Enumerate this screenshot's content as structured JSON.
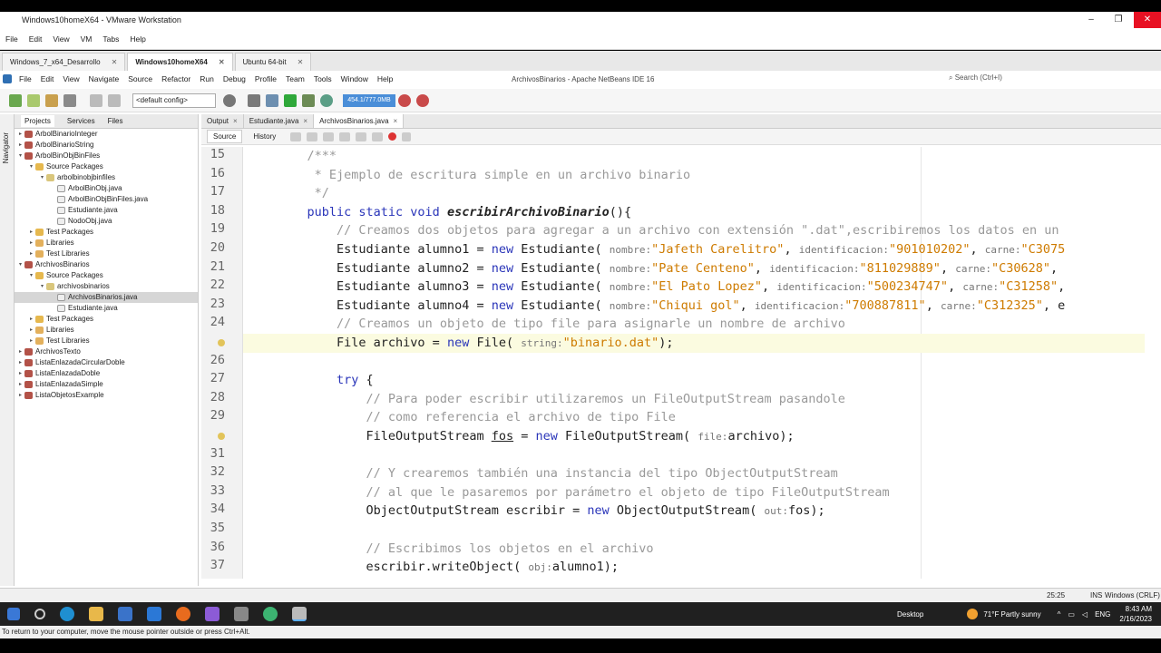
{
  "vm": {
    "title": "Windows10homeX64 - VMware Workstation",
    "menu": [
      "File",
      "Edit",
      "View",
      "VM",
      "Tabs",
      "Help"
    ],
    "tabs": [
      {
        "label": "Windows_7_x64_Desarrollo",
        "active": false
      },
      {
        "label": "Windows10homeX64",
        "active": true
      },
      {
        "label": "Ubuntu 64-bit",
        "active": false
      }
    ],
    "status": "To return to your computer, move the mouse pointer outside or press Ctrl+Alt."
  },
  "netbeans": {
    "title": "ArchivosBinarios - Apache NetBeans IDE 16",
    "search_placeholder": "Search (Ctrl+I)",
    "menu": [
      "File",
      "Edit",
      "View",
      "Navigate",
      "Source",
      "Refactor",
      "Run",
      "Debug",
      "Profile",
      "Team",
      "Tools",
      "Window",
      "Help"
    ],
    "config": "<default config>",
    "memory": "454.1/777.0MB",
    "side_label": "Navigator",
    "panel_tabs": [
      "Projects",
      "Services",
      "Files"
    ],
    "tree": [
      {
        "label": "ArbolBinarioInteger",
        "indent": 0,
        "icon": "p",
        "tw": "+"
      },
      {
        "label": "ArbolBinarioString",
        "indent": 0,
        "icon": "p",
        "tw": "+"
      },
      {
        "label": "ArbolBinObjBinFiles",
        "indent": 0,
        "icon": "p",
        "tw": "-"
      },
      {
        "label": "Source Packages",
        "indent": 1,
        "icon": "f",
        "tw": "-"
      },
      {
        "label": "arbolbinobjbinfiles",
        "indent": 2,
        "icon": "k",
        "tw": "-"
      },
      {
        "label": "ArbolBinObj.java",
        "indent": 3,
        "icon": "j",
        "tw": ""
      },
      {
        "label": "ArbolBinObjBinFiles.java",
        "indent": 3,
        "icon": "j",
        "tw": ""
      },
      {
        "label": "Estudiante.java",
        "indent": 3,
        "icon": "j",
        "tw": ""
      },
      {
        "label": "NodoObj.java",
        "indent": 3,
        "icon": "j",
        "tw": ""
      },
      {
        "label": "Test Packages",
        "indent": 1,
        "icon": "f",
        "tw": "+"
      },
      {
        "label": "Libraries",
        "indent": 1,
        "icon": "l",
        "tw": "+"
      },
      {
        "label": "Test Libraries",
        "indent": 1,
        "icon": "l",
        "tw": "+"
      },
      {
        "label": "ArchivosBinarios",
        "indent": 0,
        "icon": "p",
        "tw": "-"
      },
      {
        "label": "Source Packages",
        "indent": 1,
        "icon": "f",
        "tw": "-"
      },
      {
        "label": "archivosbinarios",
        "indent": 2,
        "icon": "k",
        "tw": "-"
      },
      {
        "label": "ArchivosBinarios.java",
        "indent": 3,
        "icon": "j",
        "tw": "",
        "sel": true
      },
      {
        "label": "Estudiante.java",
        "indent": 3,
        "icon": "j",
        "tw": ""
      },
      {
        "label": "Test Packages",
        "indent": 1,
        "icon": "f",
        "tw": "+"
      },
      {
        "label": "Libraries",
        "indent": 1,
        "icon": "l",
        "tw": "+"
      },
      {
        "label": "Test Libraries",
        "indent": 1,
        "icon": "l",
        "tw": "+"
      },
      {
        "label": "ArchivosTexto",
        "indent": 0,
        "icon": "p",
        "tw": "+"
      },
      {
        "label": "ListaEnlazadaCircularDoble",
        "indent": 0,
        "icon": "p",
        "tw": "+"
      },
      {
        "label": "ListaEnlazadaDoble",
        "indent": 0,
        "icon": "p",
        "tw": "+"
      },
      {
        "label": "ListaEnlazadaSimple",
        "indent": 0,
        "icon": "p",
        "tw": "+"
      },
      {
        "label": "ListaObjetosExample",
        "indent": 0,
        "icon": "p",
        "tw": "+"
      }
    ],
    "editor_tabs": [
      {
        "label": "Output",
        "active": false
      },
      {
        "label": "Estudiante.java",
        "active": false
      },
      {
        "label": "ArchivosBinarios.java",
        "active": true
      }
    ],
    "source_label": "Source",
    "history_label": "History",
    "status_pos": "25:25",
    "status_ins": "INS",
    "status_eol": "Windows (CRLF)"
  },
  "code": [
    {
      "n": "15",
      "html": "<span class='cm'>    /***</span>"
    },
    {
      "n": "16",
      "html": "<span class='cm'>     * Ejemplo de escritura simple en un archivo binario</span>"
    },
    {
      "n": "17",
      "html": "<span class='cm'>     */</span>"
    },
    {
      "n": "18",
      "html": "    <span class='kw'>public static void</span> <span class='it'>escribirArchivoBinario</span>(){"
    },
    {
      "n": "19",
      "html": "        <span class='cm'>// Creamos dos objetos para agregar a un archivo con extensión \".dat\",escribiremos los datos en un</span>"
    },
    {
      "n": "20",
      "html": "        Estudiante alumno1 = <span class='kw'>new</span> Estudiante( <span class='hn'>nombre:</span><span class='st'>\"Jafeth Carelitro\"</span>, <span class='hn'>identificacion:</span><span class='st'>\"901010202\"</span>, <span class='hn'>carne:</span><span class='st'>\"C3075</span>"
    },
    {
      "n": "21",
      "html": "        Estudiante alumno2 = <span class='kw'>new</span> Estudiante( <span class='hn'>nombre:</span><span class='st'>\"Pate Centeno\"</span>, <span class='hn'>identificacion:</span><span class='st'>\"811029889\"</span>, <span class='hn'>carne:</span><span class='st'>\"C30628\"</span>,"
    },
    {
      "n": "22",
      "html": "        Estudiante alumno3 = <span class='kw'>new</span> Estudiante( <span class='hn'>nombre:</span><span class='st'>\"El Pato Lopez\"</span>, <span class='hn'>identificacion:</span><span class='st'>\"500234747\"</span>, <span class='hn'>carne:</span><span class='st'>\"C31258\"</span>,"
    },
    {
      "n": "23",
      "html": "        Estudiante alumno4 = <span class='kw'>new</span> Estudiante( <span class='hn'>nombre:</span><span class='st'>\"Chiqui gol\"</span>, <span class='hn'>identificacion:</span><span class='st'>\"700887811\"</span>, <span class='hn'>carne:</span><span class='st'>\"C312325\"</span>, e"
    },
    {
      "n": "24",
      "html": "        <span class='cm'>// Creamos un objeto de tipo file para asignarle un nombre de archivo</span>"
    },
    {
      "n": "25",
      "html": "        File archivo = <span class='kw'>new</span> File( <span class='hn'>string:</span><span class='st'>\"binario.dat\"</span>);",
      "hl": true,
      "mark": true
    },
    {
      "n": "26",
      "html": ""
    },
    {
      "n": "27",
      "html": "        <span class='kw'>try</span> {"
    },
    {
      "n": "28",
      "html": "            <span class='cm'>// Para poder escribir utilizaremos un FileOutputStream pasandole</span>"
    },
    {
      "n": "29",
      "html": "            <span class='cm'>// como referencia el archivo de tipo File</span>"
    },
    {
      "n": "30",
      "html": "            FileOutputStream <span class='ul'>fos</span> = <span class='kw'>new</span> FileOutputStream( <span class='hn'>file:</span>archivo);",
      "mark": true
    },
    {
      "n": "31",
      "html": ""
    },
    {
      "n": "32",
      "html": "            <span class='cm'>// Y crearemos también una instancia del tipo ObjectOutputStream</span>"
    },
    {
      "n": "33",
      "html": "            <span class='cm'>// al que le pasaremos por parámetro el objeto de tipo FileOutputStream</span>"
    },
    {
      "n": "34",
      "html": "            ObjectOutputStream escribir = <span class='kw'>new</span> ObjectOutputStream( <span class='hn'>out:</span>fos);"
    },
    {
      "n": "35",
      "html": ""
    },
    {
      "n": "36",
      "html": "            <span class='cm'>// Escribimos los objetos en el archivo</span>"
    },
    {
      "n": "37",
      "html": "            escribir.writeObject( <span class='hn'>obj:</span>alumno1);"
    }
  ],
  "taskbar": {
    "desktop": "Desktop",
    "weather": "71°F  Partly sunny",
    "lang": "ENG",
    "time": "8:43 AM",
    "date": "2/16/2023"
  }
}
